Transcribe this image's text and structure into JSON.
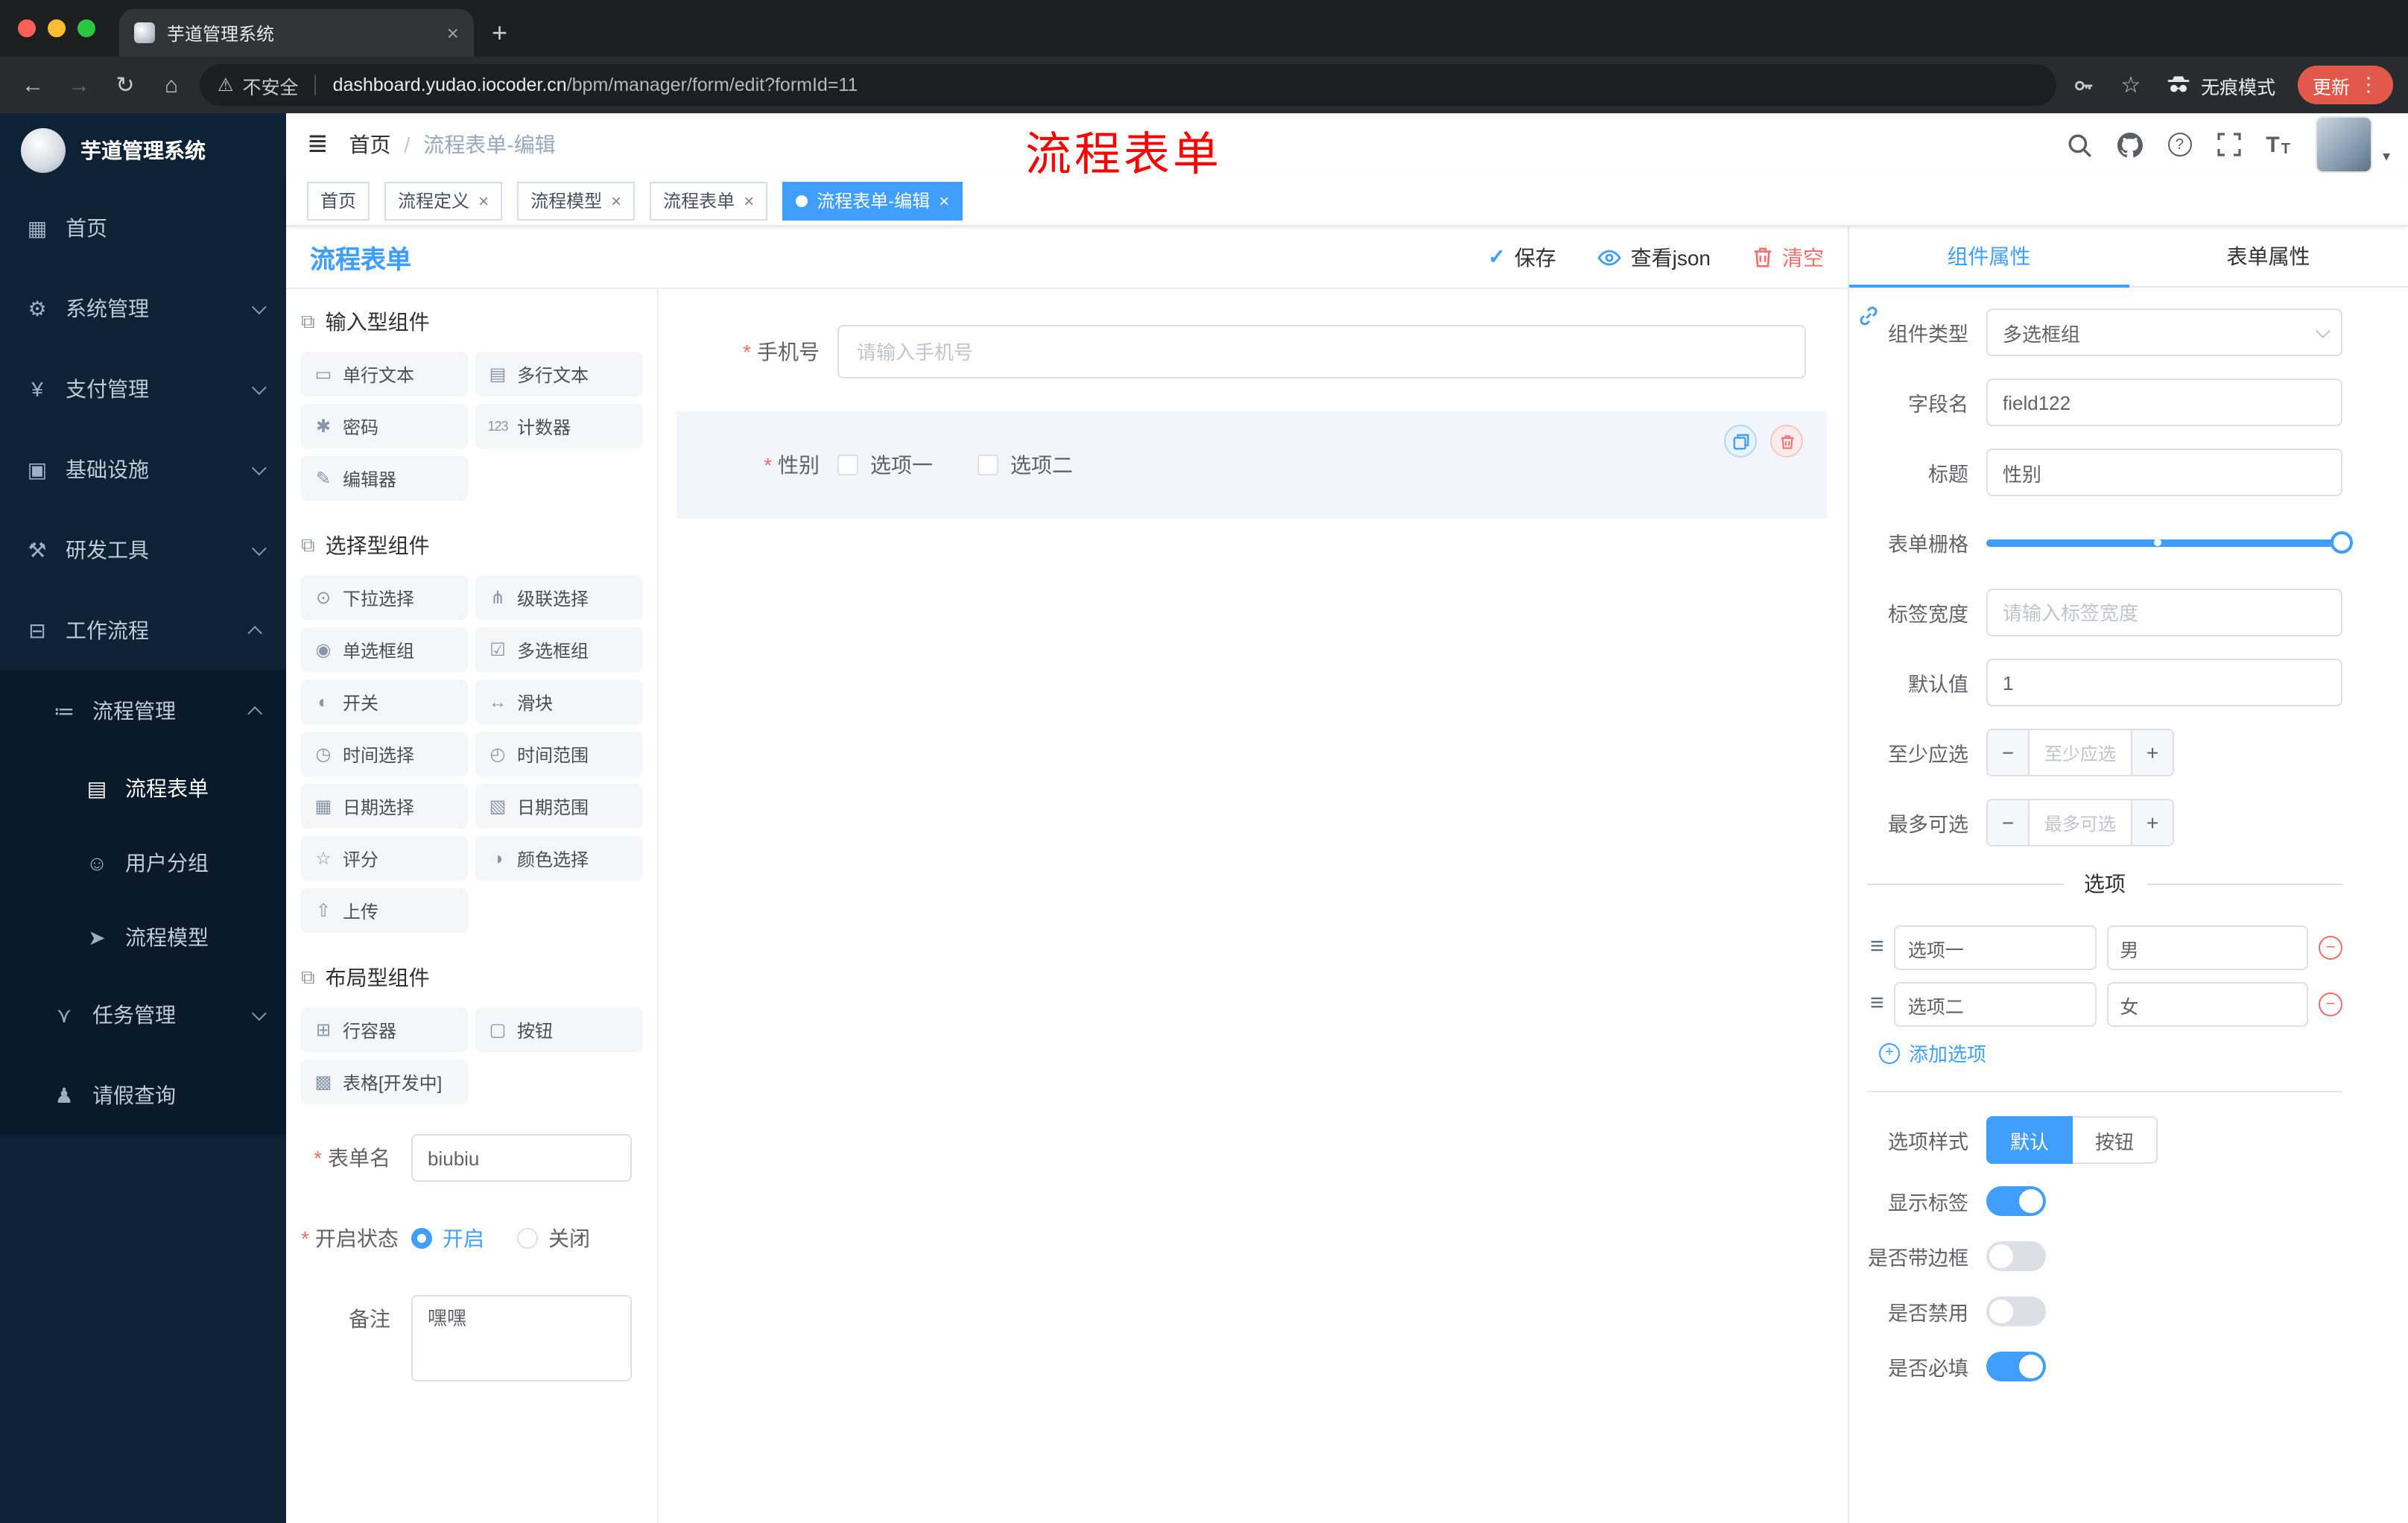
{
  "browser": {
    "tab_title": "芋道管理系统",
    "security_label": "不安全",
    "url_host": "dashboard.yudao.iocoder.cn",
    "url_path": "/bpm/manager/form/edit?formId=11",
    "incognito_label": "无痕模式",
    "update_label": "更新"
  },
  "icons": {
    "close": "×",
    "new_tab": "+",
    "back": "←",
    "forward": "→",
    "reload": "↻",
    "home": "⌂",
    "warning": "⚠",
    "star": "☆",
    "menu_dots": "⋮",
    "fold": "≣",
    "slash": "/",
    "check": "✓",
    "question": "?",
    "font": "T",
    "caret_down": "▾",
    "drag": "≡",
    "minus": "−",
    "plus": "+"
  },
  "sidebar": {
    "logo_title": "芋道管理系统",
    "items": {
      "home": {
        "label": "首页",
        "icon": "▦"
      },
      "system": {
        "label": "系统管理",
        "icon": "⚙"
      },
      "payment": {
        "label": "支付管理",
        "icon": "¥"
      },
      "infra": {
        "label": "基础设施",
        "icon": "▣"
      },
      "devtools": {
        "label": "研发工具",
        "icon": "⚒"
      },
      "workflow": {
        "label": "工作流程",
        "icon": "⊟"
      },
      "process_mgmt": {
        "label": "流程管理",
        "icon": "≔"
      },
      "process_form": {
        "label": "流程表单",
        "icon": "▤"
      },
      "user_group": {
        "label": "用户分组",
        "icon": "☺"
      },
      "process_model": {
        "label": "流程模型",
        "icon": "➤"
      },
      "task_mgmt": {
        "label": "任务管理",
        "icon": "⋎"
      },
      "leave_query": {
        "label": "请假查询",
        "icon": "♟"
      }
    }
  },
  "header": {
    "breadcrumb_home": "首页",
    "breadcrumb_sep": "/",
    "breadcrumb_current": "流程表单-编辑",
    "annotation": "流程表单"
  },
  "tags": [
    {
      "label": "首页",
      "active": false,
      "closable": false
    },
    {
      "label": "流程定义",
      "active": false,
      "closable": true
    },
    {
      "label": "流程模型",
      "active": false,
      "closable": true
    },
    {
      "label": "流程表单",
      "active": false,
      "closable": true
    },
    {
      "label": "流程表单-编辑",
      "active": true,
      "closable": true
    }
  ],
  "editor": {
    "title": "流程表单",
    "actions": {
      "save": "保存",
      "view_json": "查看json",
      "clear": "清空"
    },
    "palette": {
      "sections": [
        {
          "title": "输入型组件",
          "items": [
            {
              "icon": "▭",
              "label": "单行文本"
            },
            {
              "icon": "▤",
              "label": "多行文本"
            },
            {
              "icon": "✱",
              "label": "密码"
            },
            {
              "icon": "123",
              "label": "计数器"
            },
            {
              "icon": "✎",
              "label": "编辑器"
            }
          ]
        },
        {
          "title": "选择型组件",
          "items": [
            {
              "icon": "⊙",
              "label": "下拉选择"
            },
            {
              "icon": "⋔",
              "label": "级联选择"
            },
            {
              "icon": "◉",
              "label": "单选框组"
            },
            {
              "icon": "☑",
              "label": "多选框组"
            },
            {
              "icon": "◐",
              "label": "开关"
            },
            {
              "icon": "↔",
              "label": "滑块"
            },
            {
              "icon": "◷",
              "label": "时间选择"
            },
            {
              "icon": "◴",
              "label": "时间范围"
            },
            {
              "icon": "▦",
              "label": "日期选择"
            },
            {
              "icon": "▧",
              "label": "日期范围"
            },
            {
              "icon": "☆",
              "label": "评分"
            },
            {
              "icon": "◑",
              "label": "颜色选择"
            },
            {
              "icon": "⇧",
              "label": "上传"
            }
          ]
        },
        {
          "title": "布局型组件",
          "items": [
            {
              "icon": "⊞",
              "label": "行容器"
            },
            {
              "icon": "▢",
              "label": "按钮"
            },
            {
              "icon": "▩",
              "label": "表格[开发中]"
            }
          ]
        }
      ]
    },
    "meta": {
      "name_label": "表单名",
      "name_value": "biubiu",
      "status_label": "开启状态",
      "status_on": "开启",
      "status_off": "关闭",
      "remark_label": "备注",
      "remark_value": "嘿嘿"
    },
    "canvas": {
      "phone_label": "手机号",
      "phone_placeholder": "请输入手机号",
      "gender_label": "性别",
      "gender_opt1": "选项一",
      "gender_opt2": "选项二"
    }
  },
  "props": {
    "tab_component": "组件属性",
    "tab_form": "表单属性",
    "type_label": "组件类型",
    "type_value": "多选框组",
    "field_label": "字段名",
    "field_value": "field122",
    "title_label": "标题",
    "title_value": "性别",
    "grid_label": "表单栅格",
    "width_label": "标签宽度",
    "width_placeholder": "请输入标签宽度",
    "default_label": "默认值",
    "default_value": "1",
    "min_label": "至少应选",
    "min_placeholder": "至少应选",
    "max_label": "最多可选",
    "max_placeholder": "最多可选",
    "options_title": "选项",
    "options": [
      {
        "label": "选项一",
        "value": "男"
      },
      {
        "label": "选项二",
        "value": "女"
      }
    ],
    "add_option": "添加选项",
    "style_label": "选项样式",
    "style_default": "默认",
    "style_button": "按钮",
    "toggles": [
      {
        "label": "显示标签",
        "on": true
      },
      {
        "label": "是否带边框",
        "on": false
      },
      {
        "label": "是否禁用",
        "on": false
      },
      {
        "label": "是否必填",
        "on": true
      }
    ]
  },
  "colors": {
    "accent": "#409eff",
    "danger": "#f56c6c",
    "annotation": "#fd0100",
    "sidebar_bg": "#0e2235"
  }
}
